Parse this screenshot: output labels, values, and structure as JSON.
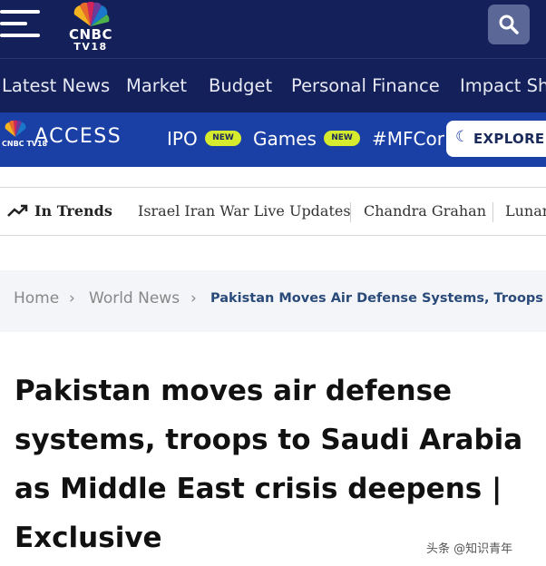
{
  "header": {
    "logo_line1": "CNBC",
    "logo_line2": "TV18",
    "menu_icon": "hamburger-menu-icon",
    "search_icon": "search-icon",
    "bg_color": "#14205a"
  },
  "main_nav": {
    "items": [
      "Latest News",
      "Market",
      "Budget",
      "Personal Finance",
      "Impact Sh"
    ]
  },
  "access_bar": {
    "logo_mini": "CNBC TV18",
    "label": "ACCESS",
    "items": [
      {
        "label": "IPO",
        "badge": "NEW"
      },
      {
        "label": "Games",
        "badge": "NEW"
      },
      {
        "label": "#MFCor",
        "badge": ""
      }
    ],
    "explore_label": "EXPLORE",
    "bg_color": "#1a40a6",
    "badge_color": "#d6ea2e"
  },
  "trends": {
    "label": "In Trends",
    "items": [
      "Israel Iran War Live Updates",
      "Chandra Grahan",
      "Lunar"
    ]
  },
  "breadcrumb": {
    "items": [
      "Home",
      "World News"
    ],
    "current": "Pakistan Moves Air Defense Systems, Troops 1"
  },
  "article": {
    "headline": "Pakistan moves air defense systems, troops to Saudi Arabia as Middle East crisis deepens | Exclusive"
  },
  "watermark": {
    "text": "头条 @知识青年"
  }
}
